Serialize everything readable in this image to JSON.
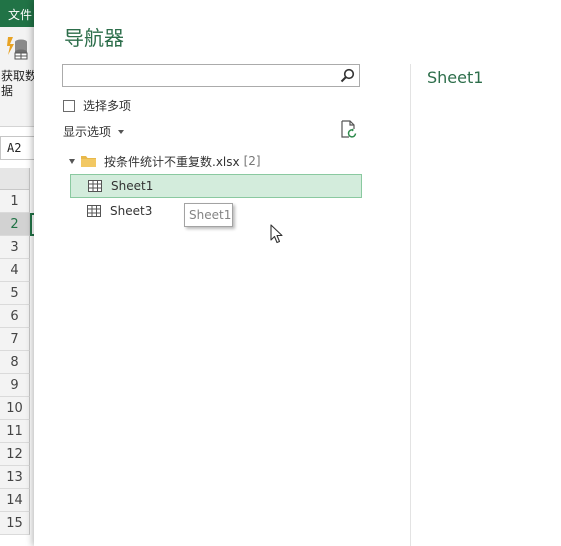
{
  "excel": {
    "file_tab": "文件",
    "get_data_label_line1": "获取数",
    "get_data_label_line2": "据",
    "name_box": "A2",
    "rows": [
      "1",
      "2",
      "3",
      "4",
      "5",
      "6",
      "7",
      "8",
      "9",
      "10",
      "11",
      "12",
      "13",
      "14",
      "15"
    ],
    "active_row_index": 1,
    "accent_color": "#217346"
  },
  "navigator": {
    "title": "导航器",
    "search": {
      "value": "",
      "placeholder": ""
    },
    "multi_select_label": "选择多项",
    "display_options_label": "显示选项",
    "tree": {
      "folder_label": "按条件统计不重复数.xlsx",
      "folder_count": "[2]",
      "items": [
        {
          "label": "Sheet1",
          "selected": true
        },
        {
          "label": "Sheet3",
          "selected": false
        }
      ]
    },
    "tooltip": "Sheet1",
    "preview_title": "Sheet1",
    "title_color": "#2d6e4b",
    "selected_color": "#d3ecdc"
  }
}
